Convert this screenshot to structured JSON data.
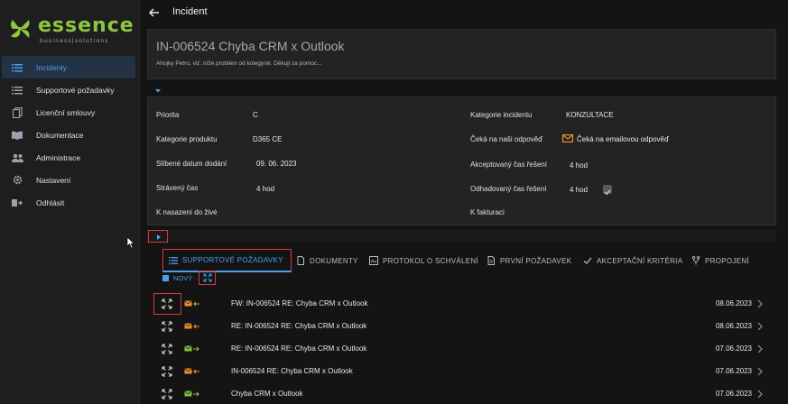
{
  "brand": {
    "name": "essence",
    "tagline": "business|solutions"
  },
  "sidebar": {
    "items": [
      {
        "label": "Incidenty",
        "icon": "list-icon",
        "active": true
      },
      {
        "label": "Supportové požadavky",
        "icon": "list-icon",
        "active": false
      },
      {
        "label": "Licenční smlouvy",
        "icon": "document-copy-icon",
        "active": false
      },
      {
        "label": "Dokumentace",
        "icon": "book-icon",
        "active": false
      },
      {
        "label": "Administrace",
        "icon": "users-icon",
        "active": false
      },
      {
        "label": "Nastavení",
        "icon": "gear-icon",
        "active": false
      },
      {
        "label": "Odhlásit",
        "icon": "logout-icon",
        "active": false
      }
    ]
  },
  "topbar": {
    "title": "Incident"
  },
  "header": {
    "title": "IN-006524 Chyba CRM x Outlook",
    "description": "Ahojky Petro,  viz. níže problém od kolegyně.  Děkuji za pomoc..."
  },
  "details": {
    "priority_label": "Priorita",
    "priority_value": "C",
    "product_label": "Kategorie produktu",
    "product_value": "D365 CE",
    "due_label": "Slíbené datum dodání",
    "due_value": "09. 06. 2023",
    "spent_label": "Strávený čas",
    "spent_value": "4 hod",
    "deploy_label": "K nasazení do živé",
    "category_label": "Kategorie incidentu",
    "category_value": "KONZULTACE",
    "waiting_label": "Čeká na naši odpověď",
    "waiting_value": "Čeká na emailovou odpověď",
    "accepted_label": "Akceptovaný čas řešení",
    "accepted_value": "4 hod",
    "estimated_label": "Odhadovaný čas řešení",
    "estimated_value": "4 hod",
    "billing_label": "K fakturaci"
  },
  "tabs": [
    {
      "label": "SUPPORTOVÉ POŽADAVKY",
      "icon": "list-icon",
      "active": true
    },
    {
      "label": "DOKUMENTY",
      "icon": "document-icon",
      "active": false
    },
    {
      "label": "PROTOKOL O SCHVÁLENÍ",
      "icon": "signature-icon",
      "active": false
    },
    {
      "label": "PRVNÍ POŽADAVEK",
      "icon": "file-icon",
      "active": false
    },
    {
      "label": "AKCEPTAČNÍ KRITÉRIA",
      "icon": "check-icon",
      "active": false
    },
    {
      "label": "PROPOJENÍ",
      "icon": "branch-icon",
      "active": false
    }
  ],
  "new_label": "NOVÝ",
  "requests": [
    {
      "subject": "FW: IN-006524 RE: Chyba CRM x Outlook",
      "date": "08.06.2023",
      "direction": "incoming",
      "color": "#e8912c"
    },
    {
      "subject": "RE: IN-006524 RE: Chyba CRM x Outlook",
      "date": "08.06.2023",
      "direction": "incoming",
      "color": "#e8912c"
    },
    {
      "subject": "RE: IN-006524 RE: Chyba CRM x Outlook",
      "date": "07.06.2023",
      "direction": "outgoing",
      "color": "#7cc142"
    },
    {
      "subject": "IN-006524 RE: Chyba CRM x Outlook",
      "date": "07.06.2023",
      "direction": "incoming",
      "color": "#e8912c"
    },
    {
      "subject": "Chyba CRM x Outlook",
      "date": "07.06.2023",
      "direction": "outgoing",
      "color": "#7cc142"
    }
  ]
}
